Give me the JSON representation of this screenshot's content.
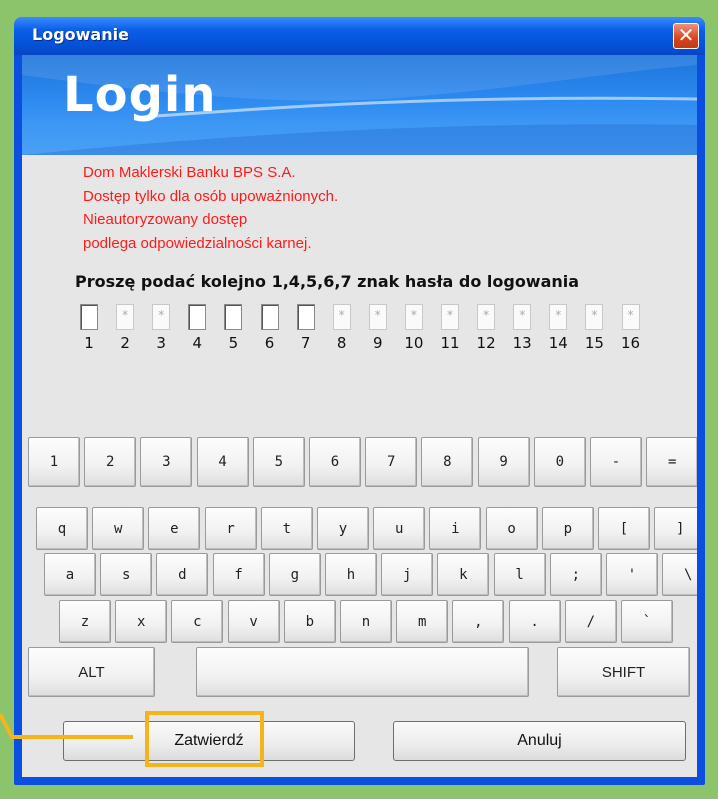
{
  "window": {
    "title": "Logowanie",
    "close_symbol": "✕"
  },
  "banner": {
    "heading": "Login"
  },
  "notice": {
    "lines": [
      "Dom Maklerski Banku BPS S.A.",
      "Dostęp tylko dla osób upoważnionych.",
      "Nieautoryzowany dostęp",
      "podlega odpowiedzialności karnej."
    ]
  },
  "password": {
    "prompt": "Proszę podać kolejno 1,4,5,6,7 znak hasła do logowania",
    "positions": [
      "1",
      "2",
      "3",
      "4",
      "5",
      "6",
      "7",
      "8",
      "9",
      "10",
      "11",
      "12",
      "13",
      "14",
      "15",
      "16"
    ],
    "masked_char": "*",
    "required_positions": [
      1,
      4,
      5,
      6,
      7
    ]
  },
  "keyboard": {
    "row1": [
      "1",
      "2",
      "3",
      "4",
      "5",
      "6",
      "7",
      "8",
      "9",
      "0",
      "-",
      "="
    ],
    "row2": [
      "q",
      "w",
      "e",
      "r",
      "t",
      "y",
      "u",
      "i",
      "o",
      "p",
      "[",
      "]"
    ],
    "row3": [
      "a",
      "s",
      "d",
      "f",
      "g",
      "h",
      "j",
      "k",
      "l",
      ";",
      "'",
      "\\"
    ],
    "row4": [
      "z",
      "x",
      "c",
      "v",
      "b",
      "n",
      "m",
      ",",
      ".",
      "/",
      "`"
    ],
    "alt_label": "ALT",
    "shift_label": "SHIFT",
    "space_label": ""
  },
  "actions": {
    "confirm_label": "Zatwierdź",
    "cancel_label": "Anuluj"
  },
  "colors": {
    "title_bar": "#0a5ee6",
    "notice_text": "#ff1a1a",
    "highlight": "#f5b41a",
    "background": "#8cc46c"
  }
}
